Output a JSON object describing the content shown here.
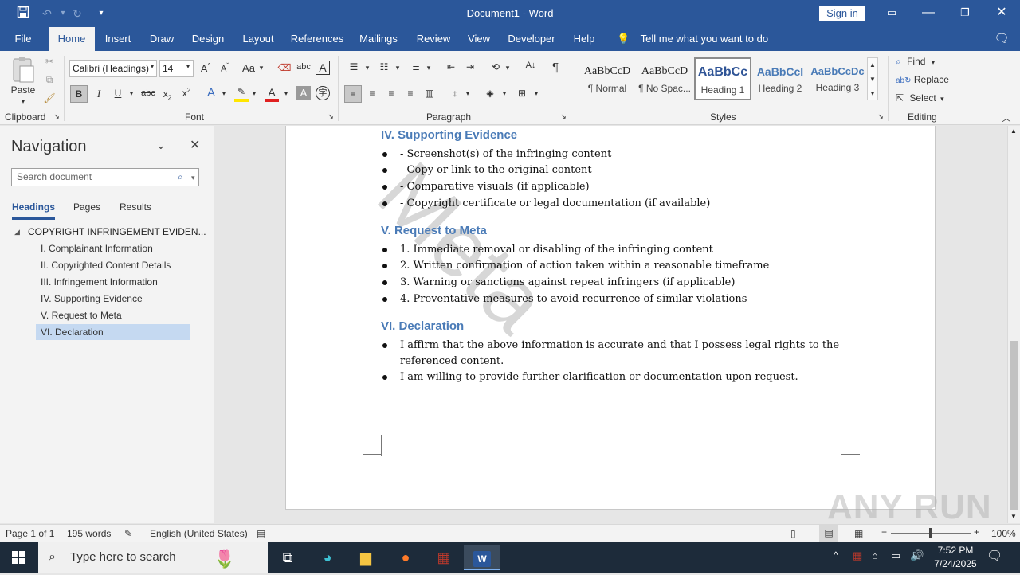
{
  "app": {
    "doc_title": "Document1  -  Word",
    "sign_in": "Sign in",
    "tell_me": "Tell me what you want to do"
  },
  "tabs": [
    "File",
    "Home",
    "Insert",
    "Draw",
    "Design",
    "Layout",
    "References",
    "Mailings",
    "Review",
    "View",
    "Developer",
    "Help"
  ],
  "active_tab": "Home",
  "ribbon": {
    "clipboard": {
      "paste": "Paste",
      "label": "Clipboard"
    },
    "font": {
      "name": "Calibri (Headings)",
      "size": "14",
      "label": "Font",
      "case_btn": "Aa"
    },
    "paragraph": {
      "label": "Paragraph"
    },
    "styles": {
      "label": "Styles",
      "items": [
        {
          "preview": "AaBbCcD",
          "name": "¶ Normal"
        },
        {
          "preview": "AaBbCcD",
          "name": "¶ No Spac..."
        },
        {
          "preview": "AaBbCc",
          "name": "Heading 1"
        },
        {
          "preview": "AaBbCcI",
          "name": "Heading 2"
        },
        {
          "preview": "AaBbCcDc",
          "name": "Heading 3"
        }
      ],
      "selected": "Heading 1"
    },
    "editing": {
      "label": "Editing",
      "find": "Find",
      "replace": "Replace",
      "select": "Select"
    }
  },
  "navigation": {
    "title": "Navigation",
    "search_placeholder": "Search document",
    "tabs": [
      "Headings",
      "Pages",
      "Results"
    ],
    "active_tab": "Headings",
    "root": "COPYRIGHT INFRINGEMENT EVIDEN...",
    "headings": [
      "I. Complainant Information",
      "II. Copyrighted Content Details",
      "III. Infringement Information",
      "IV. Supporting Evidence",
      "V. Request to Meta",
      "VI. Declaration"
    ],
    "selected_heading": "VI. Declaration"
  },
  "document": {
    "watermark": "Meta",
    "sections": [
      {
        "heading": "IV. Supporting Evidence",
        "items": [
          "- Screenshot(s) of the infringing content",
          "- Copy or link to the original content",
          "- Comparative visuals (if applicable)",
          "- Copyright certificate or legal documentation (if available)"
        ]
      },
      {
        "heading": "V. Request to Meta",
        "items": [
          "1. Immediate removal or disabling of the infringing content",
          "2. Written confirmation of action taken within a reasonable timeframe",
          "3. Warning or sanctions against repeat infringers (if applicable)",
          "4. Preventative measures to avoid recurrence of similar violations"
        ]
      },
      {
        "heading": "VI. Declaration",
        "items": [
          "I affirm that the above information is accurate and that I possess legal rights to the",
          "referenced content.",
          "I am willing to provide further clarification or documentation upon request."
        ]
      }
    ]
  },
  "statusbar": {
    "page": "Page 1 of 1",
    "words": "195 words",
    "language": "English (United States)",
    "zoom": "100%"
  },
  "taskbar": {
    "search_placeholder": "Type here to search",
    "time": "7:52 PM",
    "date": "7/24/2025"
  },
  "overlay_watermark": "ANY RUN",
  "colors": {
    "accent": "#2b579a",
    "heading": "#4a7bb7",
    "nav_selected": "#c5d9f1"
  }
}
